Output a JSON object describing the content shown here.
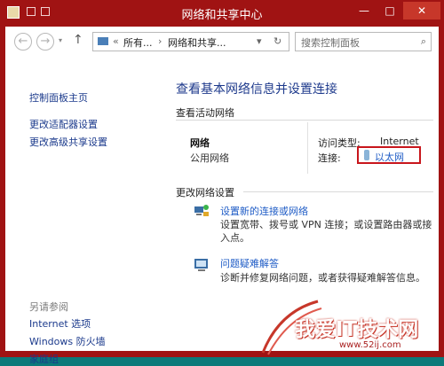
{
  "window": {
    "title": "网络和共享中心",
    "minimize": "—",
    "maximize": "□",
    "close": "✕"
  },
  "toolbar": {
    "back": "←",
    "forward": "→",
    "dropdown": "▾",
    "up": "↑",
    "address": {
      "chevron": "«",
      "crumb1": "所有...",
      "sep1": "›",
      "crumb2": "网络和共享...",
      "dropdown": "▾",
      "refresh": "↻"
    },
    "search_placeholder": "搜索控制面板",
    "search_icon": "search-icon"
  },
  "sidebar": {
    "home": "控制面板主页",
    "links": [
      "更改适配器设置",
      "更改高级共享设置"
    ],
    "see_also_heading": "另请参阅",
    "see_also": [
      "Internet 选项",
      "Windows 防火墙",
      "家庭组"
    ]
  },
  "main": {
    "heading": "查看基本网络信息并设置连接",
    "active_networks_label": "查看活动网络",
    "network": {
      "name": "网络",
      "type": "公用网络",
      "access_type_label": "访问类型:",
      "access_type_value": "Internet",
      "connection_label": "连接:",
      "connection_value": "以太网"
    },
    "change_settings_label": "更改网络设置",
    "tasks": [
      {
        "icon": "network-setup-icon",
        "link": "设置新的连接或网络",
        "desc": "设置宽带、拨号或 VPN 连接；或设置路由器或接入点。"
      },
      {
        "icon": "troubleshoot-icon",
        "link": "问题疑难解答",
        "desc": "诊断并修复网络问题，或者获得疑难解答信息。"
      }
    ]
  },
  "watermark": {
    "text": "我爱IT技术网",
    "url": "www.52ij.com"
  },
  "colors": {
    "frame": "#a01313",
    "link": "#1f5cc6",
    "heading": "#1e3a8c",
    "highlight_box": "#c8161c"
  }
}
